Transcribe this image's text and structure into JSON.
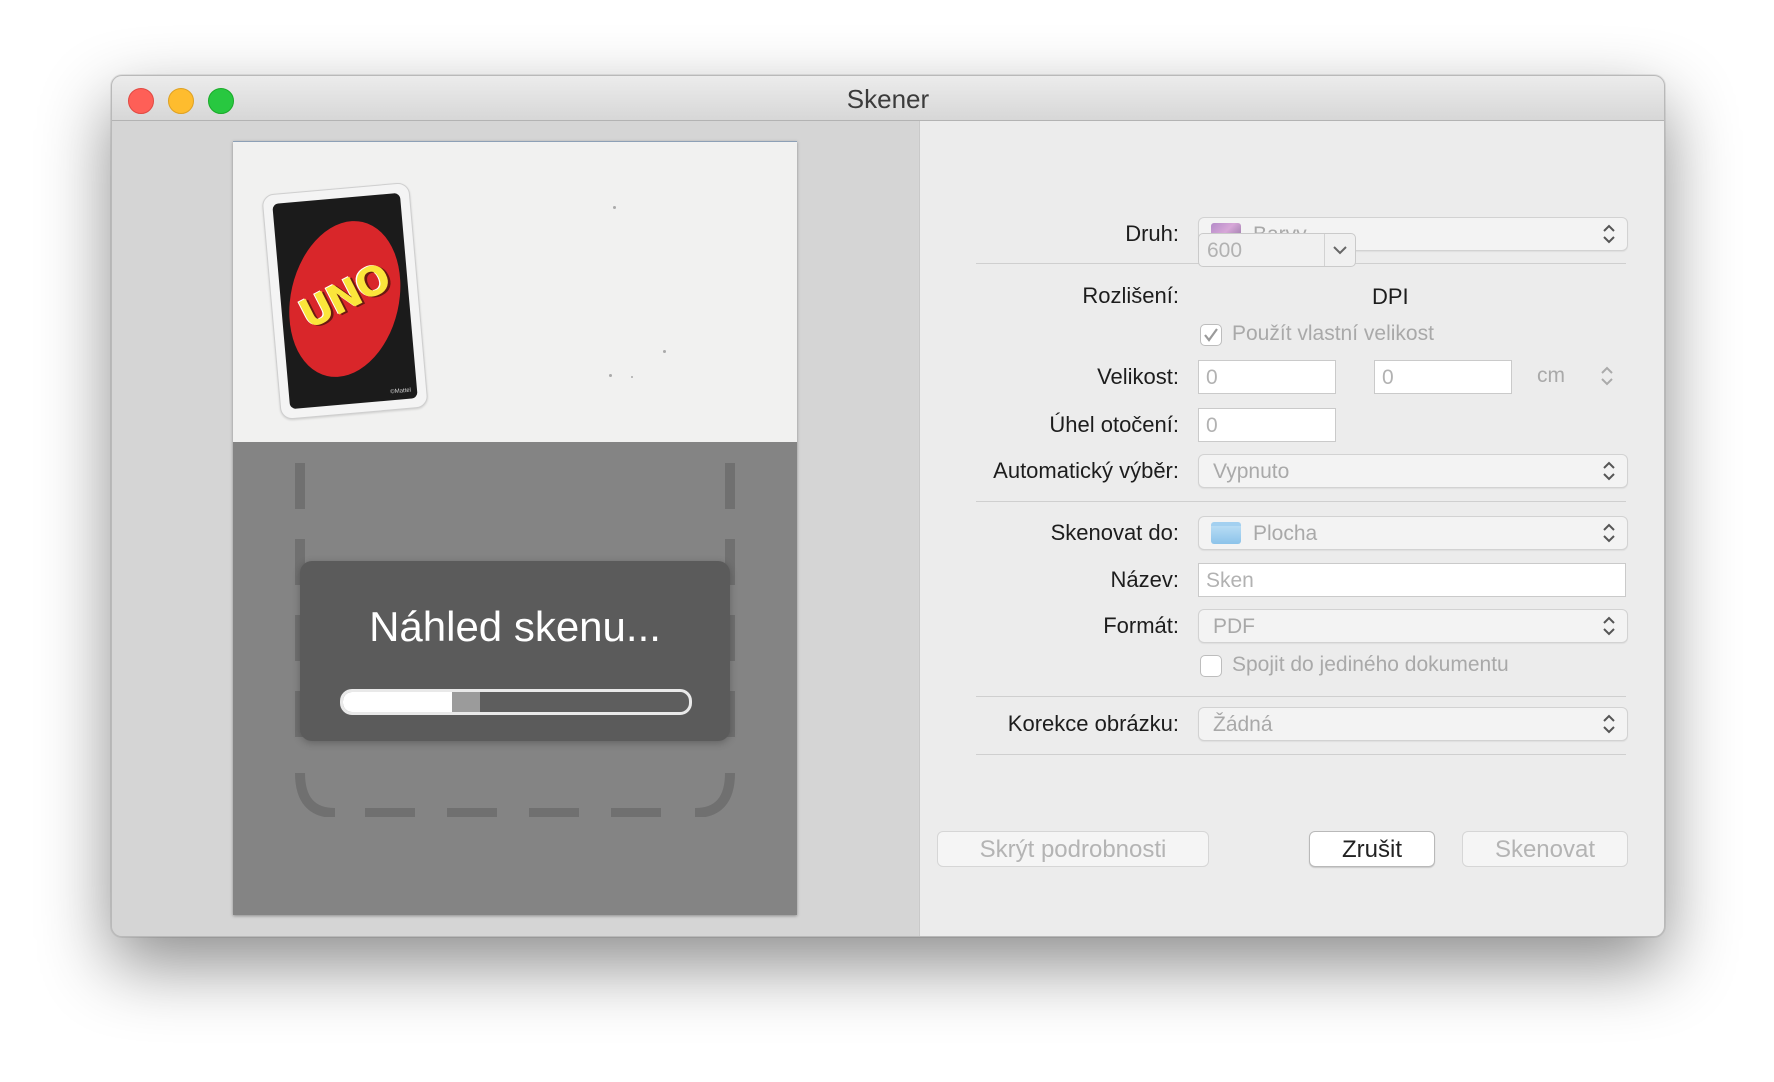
{
  "window": {
    "title": "Skener"
  },
  "preview": {
    "overlay_text": "Náhled skenu...",
    "progress": 0.32,
    "card_logo": "UNO",
    "card_copyright": "©Mattel"
  },
  "settings": {
    "druh": {
      "label": "Druh:",
      "value": "Barvy",
      "icon": "color-flower-icon"
    },
    "rozliseni": {
      "label": "Rozlišení:",
      "value": "600",
      "unit": "DPI"
    },
    "vlastni_velikost": {
      "label": "Použít vlastní velikost",
      "checked": true
    },
    "velikost": {
      "label": "Velikost:",
      "width": "0",
      "height": "0",
      "unit": "cm"
    },
    "uhel": {
      "label": "Úhel otočení:",
      "value": "0"
    },
    "auto_vyber": {
      "label": "Automatický výběr:",
      "value": "Vypnuto"
    },
    "skenovat_do": {
      "label": "Skenovat do:",
      "value": "Plocha",
      "icon": "folder-icon"
    },
    "nazev": {
      "label": "Název:",
      "placeholder": "Sken"
    },
    "format": {
      "label": "Formát:",
      "value": "PDF"
    },
    "spojit": {
      "label": "Spojit do jediného dokumentu",
      "checked": false
    },
    "korekce": {
      "label": "Korekce obrázku:",
      "value": "Žádná"
    }
  },
  "buttons": {
    "hide_details": "Skrýt podrobnosti",
    "cancel": "Zrušit",
    "scan": "Skenovat"
  },
  "colors": {
    "close": "#fe5f57",
    "minimize": "#febc2e",
    "maximize": "#28c840",
    "uno_red": "#d9262a",
    "uno_yellow": "#fbe53b",
    "overlay": "#5b5b5b"
  }
}
